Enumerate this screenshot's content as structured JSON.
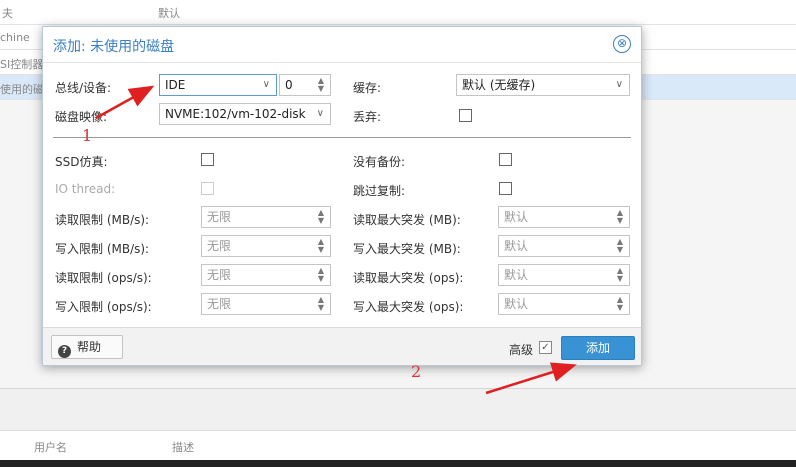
{
  "background": {
    "top_row_fragment": "夫",
    "top_row_default": "默认",
    "rows": [
      "chine",
      "SI控制器",
      "使用的磁"
    ],
    "table_headers": [
      "用户名",
      "描述"
    ]
  },
  "dialog": {
    "title": "添加: 未使用的磁盘",
    "close_icon": "⊗",
    "bus_device": {
      "label": "总线/设备:",
      "bus_value": "IDE",
      "device_value": "0"
    },
    "cache": {
      "label": "缓存:",
      "value": "默认 (无缓存)"
    },
    "disk_image": {
      "label": "磁盘映像:",
      "value": "NVME:102/vm-102-disk"
    },
    "discard": {
      "label": "丢弃:"
    },
    "ssd_emulation": {
      "label": "SSD仿真:"
    },
    "no_backup": {
      "label": "没有备份:"
    },
    "io_thread": {
      "label": "IO thread:"
    },
    "skip_replication": {
      "label": "跳过复制:"
    },
    "limits": {
      "read_mbs": {
        "label": "读取限制 (MB/s):",
        "placeholder": "无限"
      },
      "write_mbs": {
        "label": "写入限制 (MB/s):",
        "placeholder": "无限"
      },
      "read_ops": {
        "label": "读取限制 (ops/s):",
        "placeholder": "无限"
      },
      "write_ops": {
        "label": "写入限制 (ops/s):",
        "placeholder": "无限"
      },
      "read_burst_mb": {
        "label": "读取最大突发 (MB):",
        "placeholder": "默认"
      },
      "write_burst_mb": {
        "label": "写入最大突发 (MB):",
        "placeholder": "默认"
      },
      "read_burst_ops": {
        "label": "读取最大突发 (ops):",
        "placeholder": "默认"
      },
      "write_burst_ops": {
        "label": "写入最大突发 (ops):",
        "placeholder": "默认"
      }
    },
    "footer": {
      "help_label": "帮助",
      "help_icon": "?",
      "advanced_label": "高级",
      "advanced_checked": "✓",
      "add_label": "添加"
    }
  },
  "annotations": {
    "marker_1": "1",
    "marker_2": "2",
    "color": "#e02020"
  }
}
